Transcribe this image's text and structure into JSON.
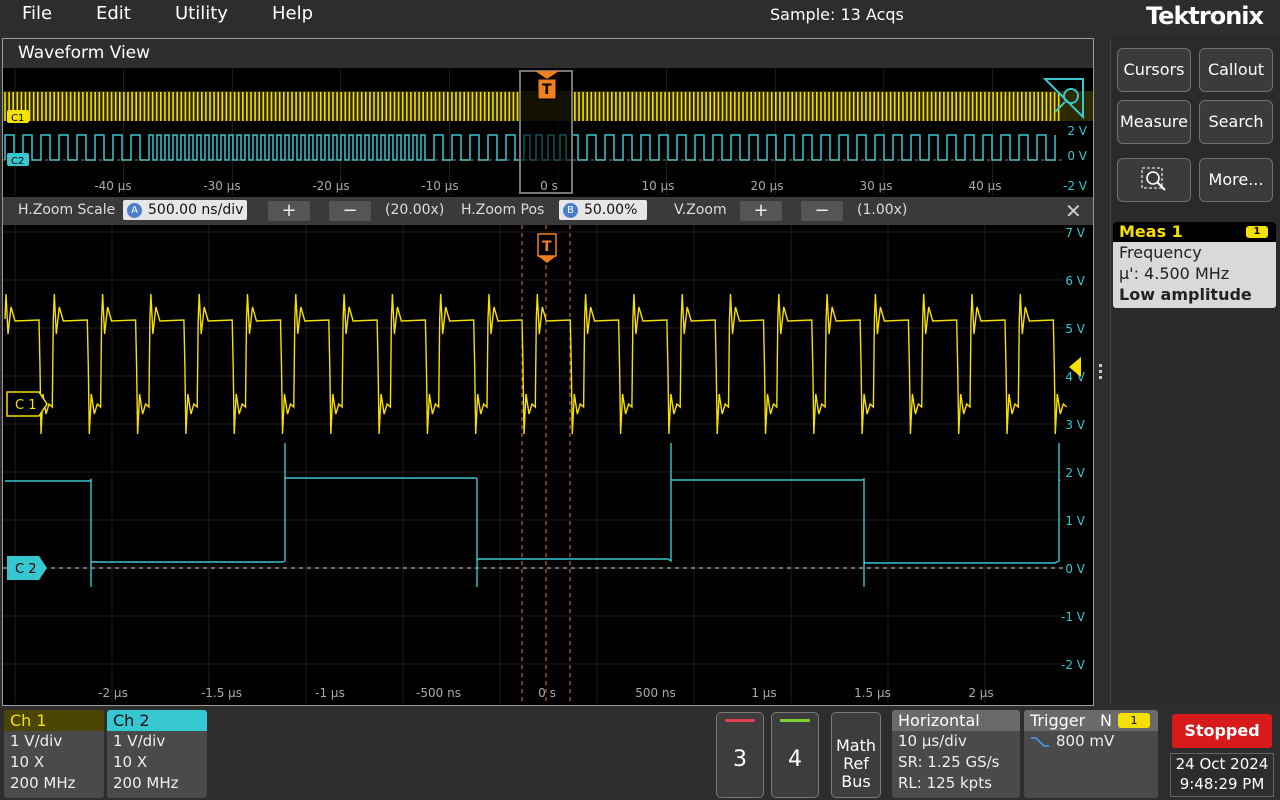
{
  "menu": {
    "file": "File",
    "edit": "Edit",
    "utility": "Utility",
    "help": "Help"
  },
  "acq_status": "Sample: 13 Acqs",
  "brand": "Tektronix",
  "waveform_view": {
    "title": "Waveform View"
  },
  "overview": {
    "time_labels": [
      "-40 µs",
      "-30 µs",
      "-20 µs",
      "-10 µs",
      "0 s",
      "10 µs",
      "20 µs",
      "30 µs",
      "40 µs"
    ],
    "volt_labels": [
      "2 V",
      "0 V",
      "-2 V"
    ],
    "ch1_tag": "C1",
    "ch2_tag": "C2",
    "trigger_tag": "T"
  },
  "zoom": {
    "scale_label": "H.Zoom Scale",
    "scale_badge": "A",
    "scale_value": "500.00 ns/div",
    "scale_factor": "(20.00x)",
    "pos_label": "H.Zoom Pos",
    "pos_badge": "B",
    "pos_value": "50.00%",
    "vzoom_label": "V.Zoom",
    "vzoom_factor": "(1.00x)",
    "plus": "+",
    "minus": "−",
    "close": "✕"
  },
  "main": {
    "volt_labels": [
      "7 V",
      "6 V",
      "5 V",
      "4 V",
      "3 V",
      "2 V",
      "1 V",
      "0 V",
      "-1 V",
      "-2 V"
    ],
    "time_labels": [
      "-2 µs",
      "-1.5 µs",
      "-1 µs",
      "-500 ns",
      "0 s",
      "500 ns",
      "1 µs",
      "1.5 µs",
      "2 µs"
    ],
    "ch1_tag": "C 1",
    "ch2_tag": "C 2",
    "trigger_tag": "T"
  },
  "side": {
    "cursors": "Cursors",
    "callout": "Callout",
    "measure": "Measure",
    "search": "Search",
    "more": "More..."
  },
  "meas1": {
    "title": "Meas 1",
    "badge": "1",
    "name": "Frequency",
    "value": "µ': 4.500 MHz",
    "warning": "Low amplitude"
  },
  "ch1": {
    "title": "Ch 1",
    "scale": "1 V/div",
    "probe": "10 X",
    "bw": "200 MHz"
  },
  "ch2": {
    "title": "Ch 2",
    "scale": "1 V/div",
    "probe": "10 X",
    "bw": "200 MHz"
  },
  "btn3": "3",
  "btn4": "4",
  "mrb": {
    "l1": "Math",
    "l2": "Ref",
    "l3": "Bus"
  },
  "horizontal": {
    "title": "Horizontal",
    "scale": "10 µs/div",
    "sr": "SR: 1.25 GS/s",
    "rl": "RL: 125 kpts"
  },
  "trigger": {
    "title": "Trigger",
    "mode": "N",
    "badge": "1",
    "level": "800 mV"
  },
  "run_state": "Stopped",
  "date": "24 Oct 2024",
  "time": "9:48:29 PM",
  "colors": {
    "ch1": "#f5e000",
    "ch2": "#35c8d0",
    "trigger": "#f07f1e"
  }
}
